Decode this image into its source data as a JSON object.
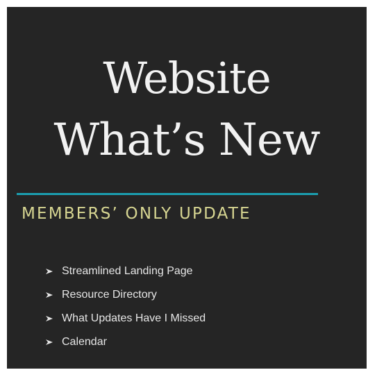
{
  "title": {
    "line1": "Website",
    "line2": "What’s New"
  },
  "subtitle": "MEMBERS’ ONLY UPDATE",
  "bullet_icon": "arrow-bullet-icon",
  "colors": {
    "background": "#252525",
    "title": "#f2f2f2",
    "divider": "#1b9fb0",
    "subtitle": "#d7d692",
    "list_text": "#e6e6e6"
  },
  "items": [
    {
      "label": "Streamlined Landing Page"
    },
    {
      "label": "Resource Directory"
    },
    {
      "label": "What Updates Have I Missed"
    },
    {
      "label": "Calendar"
    }
  ]
}
